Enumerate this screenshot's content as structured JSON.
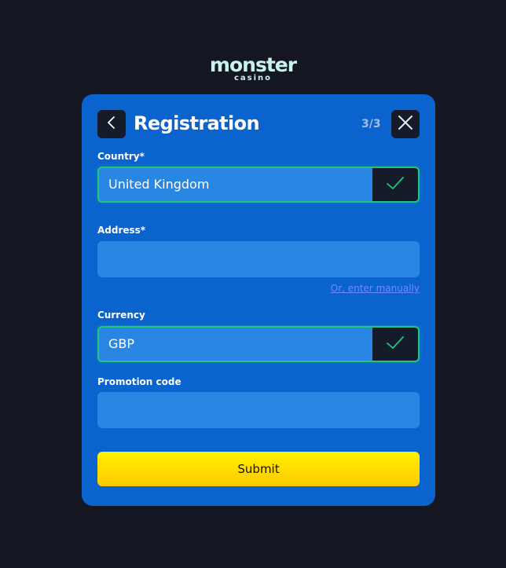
{
  "brand": {
    "logo_main": "monster",
    "logo_sub": "casino"
  },
  "modal": {
    "title": "Registration",
    "step": "3/3",
    "back_icon": "chevron-left-icon",
    "close_icon": "close-icon"
  },
  "form": {
    "country": {
      "label": "Country*",
      "value": "United Kingdom",
      "status_icon": "check-icon"
    },
    "address": {
      "label": "Address*",
      "value": "",
      "manual_link": "Or, enter manually"
    },
    "currency": {
      "label": "Currency",
      "value": "GBP",
      "status_icon": "check-icon"
    },
    "promo": {
      "label": "Promotion code",
      "value": ""
    },
    "submit_label": "Submit"
  },
  "colors": {
    "page_bg": "#141722",
    "modal_bg": "#0b63ce",
    "field_bg": "#2a86e3",
    "valid": "#20c67f",
    "submit": "#ffd400",
    "link": "#6f8bff"
  }
}
